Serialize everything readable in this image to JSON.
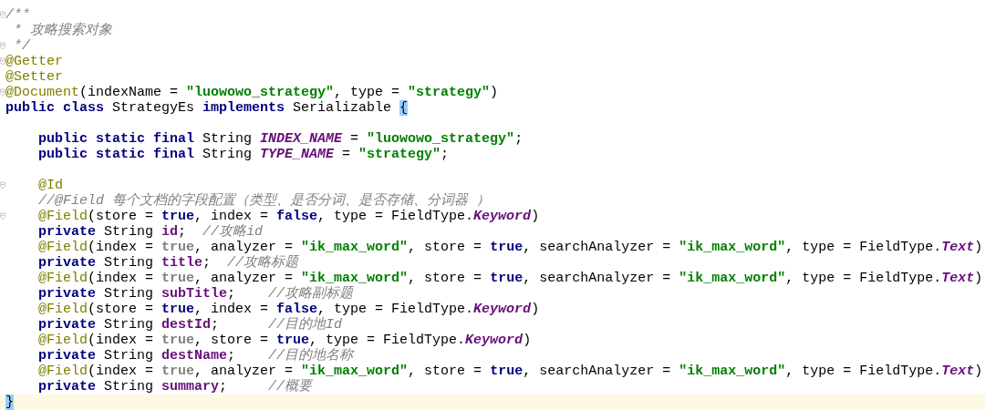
{
  "editor": {
    "lines": [
      {
        "fold": true,
        "current": false,
        "tokens": [
          {
            "kind": "comment",
            "text": "/**"
          }
        ]
      },
      {
        "fold": false,
        "current": false,
        "tokens": [
          {
            "kind": "comment",
            "text": " * 攻略搜索对象"
          }
        ]
      },
      {
        "fold": true,
        "current": false,
        "tokens": [
          {
            "kind": "comment",
            "text": " */"
          }
        ]
      },
      {
        "fold": true,
        "current": false,
        "tokens": [
          {
            "kind": "annotation",
            "text": "@Getter"
          }
        ]
      },
      {
        "fold": false,
        "current": false,
        "tokens": [
          {
            "kind": "annotation",
            "text": "@Setter"
          }
        ]
      },
      {
        "fold": true,
        "current": false,
        "tokens": [
          {
            "kind": "annotation",
            "text": "@Document"
          },
          {
            "kind": "plain",
            "text": "(indexName = "
          },
          {
            "kind": "string",
            "text": "\"luowowo_strategy\""
          },
          {
            "kind": "plain",
            "text": ", type = "
          },
          {
            "kind": "string",
            "text": "\"strategy\""
          },
          {
            "kind": "plain",
            "text": ")"
          }
        ]
      },
      {
        "fold": false,
        "current": false,
        "tokens": [
          {
            "kind": "keyword",
            "text": "public class"
          },
          {
            "kind": "plain",
            "text": " StrategyEs "
          },
          {
            "kind": "keyword",
            "text": "implements"
          },
          {
            "kind": "plain",
            "text": " Serializable "
          },
          {
            "kind": "match",
            "text": "{"
          }
        ]
      },
      {
        "fold": false,
        "current": false
      },
      {
        "fold": false,
        "current": false,
        "tokens": [
          {
            "kind": "keyword",
            "text": "    public static final"
          },
          {
            "kind": "plain",
            "text": " String "
          },
          {
            "kind": "constant",
            "text": "INDEX_NAME"
          },
          {
            "kind": "plain",
            "text": " = "
          },
          {
            "kind": "string",
            "text": "\"luowowo_strategy\""
          },
          {
            "kind": "plain",
            "text": ";"
          }
        ]
      },
      {
        "fold": false,
        "current": false,
        "tokens": [
          {
            "kind": "keyword",
            "text": "    public static final"
          },
          {
            "kind": "plain",
            "text": " String "
          },
          {
            "kind": "constant",
            "text": "TYPE_NAME"
          },
          {
            "kind": "plain",
            "text": " = "
          },
          {
            "kind": "string",
            "text": "\"strategy\""
          },
          {
            "kind": "plain",
            "text": ";"
          }
        ]
      },
      {
        "fold": false,
        "current": false
      },
      {
        "fold": true,
        "current": false,
        "tokens": [
          {
            "kind": "annotation",
            "text": "    @Id"
          }
        ]
      },
      {
        "fold": false,
        "current": false,
        "tokens": [
          {
            "kind": "comment",
            "text": "    //@Field 每个文档的字段配置（类型、是否分词、是否存储、分词器 ）"
          }
        ]
      },
      {
        "fold": true,
        "current": false,
        "tokens": [
          {
            "kind": "annotation",
            "text": "    @Field"
          },
          {
            "kind": "plain",
            "text": "(store = "
          },
          {
            "kind": "keyword",
            "text": "true"
          },
          {
            "kind": "plain",
            "text": ", index = "
          },
          {
            "kind": "keyword",
            "text": "false"
          },
          {
            "kind": "plain",
            "text": ", type = FieldType."
          },
          {
            "kind": "constant",
            "text": "Keyword"
          },
          {
            "kind": "plain",
            "text": ")"
          }
        ]
      },
      {
        "fold": false,
        "current": false,
        "tokens": [
          {
            "kind": "keyword",
            "text": "    private"
          },
          {
            "kind": "plain",
            "text": " String "
          },
          {
            "kind": "field",
            "text": "id"
          },
          {
            "kind": "plain",
            "text": ";  "
          },
          {
            "kind": "comment",
            "text": "//攻略id"
          }
        ]
      },
      {
        "fold": false,
        "current": false,
        "tokens": [
          {
            "kind": "annotation",
            "text": "    @Field"
          },
          {
            "kind": "plain",
            "text": "(index = "
          },
          {
            "kind": "dim",
            "text": "true"
          },
          {
            "kind": "plain",
            "text": ", analyzer = "
          },
          {
            "kind": "string",
            "text": "\"ik_max_word\""
          },
          {
            "kind": "plain",
            "text": ", store = "
          },
          {
            "kind": "keyword",
            "text": "true"
          },
          {
            "kind": "plain",
            "text": ", searchAnalyzer = "
          },
          {
            "kind": "string",
            "text": "\"ik_max_word\""
          },
          {
            "kind": "plain",
            "text": ", type = FieldType."
          },
          {
            "kind": "constant",
            "text": "Text"
          },
          {
            "kind": "plain",
            "text": ")"
          }
        ]
      },
      {
        "fold": false,
        "current": false,
        "tokens": [
          {
            "kind": "keyword",
            "text": "    private"
          },
          {
            "kind": "plain",
            "text": " String "
          },
          {
            "kind": "field",
            "text": "title"
          },
          {
            "kind": "plain",
            "text": ";  "
          },
          {
            "kind": "comment",
            "text": "//攻略标题"
          }
        ]
      },
      {
        "fold": false,
        "current": false,
        "tokens": [
          {
            "kind": "annotation",
            "text": "    @Field"
          },
          {
            "kind": "plain",
            "text": "(index = "
          },
          {
            "kind": "dim",
            "text": "true"
          },
          {
            "kind": "plain",
            "text": ", analyzer = "
          },
          {
            "kind": "string",
            "text": "\"ik_max_word\""
          },
          {
            "kind": "plain",
            "text": ", store = "
          },
          {
            "kind": "keyword",
            "text": "true"
          },
          {
            "kind": "plain",
            "text": ", searchAnalyzer = "
          },
          {
            "kind": "string",
            "text": "\"ik_max_word\""
          },
          {
            "kind": "plain",
            "text": ", type = FieldType."
          },
          {
            "kind": "constant",
            "text": "Text"
          },
          {
            "kind": "plain",
            "text": ")"
          }
        ]
      },
      {
        "fold": false,
        "current": false,
        "tokens": [
          {
            "kind": "keyword",
            "text": "    private"
          },
          {
            "kind": "plain",
            "text": " String "
          },
          {
            "kind": "field",
            "text": "subTitle"
          },
          {
            "kind": "plain",
            "text": ";    "
          },
          {
            "kind": "comment",
            "text": "//攻略副标题"
          }
        ]
      },
      {
        "fold": false,
        "current": false,
        "tokens": [
          {
            "kind": "annotation",
            "text": "    @Field"
          },
          {
            "kind": "plain",
            "text": "(store = "
          },
          {
            "kind": "keyword",
            "text": "true"
          },
          {
            "kind": "plain",
            "text": ", index = "
          },
          {
            "kind": "keyword",
            "text": "false"
          },
          {
            "kind": "plain",
            "text": ", type = FieldType."
          },
          {
            "kind": "constant",
            "text": "Keyword"
          },
          {
            "kind": "plain",
            "text": ")"
          }
        ]
      },
      {
        "fold": false,
        "current": false,
        "tokens": [
          {
            "kind": "keyword",
            "text": "    private"
          },
          {
            "kind": "plain",
            "text": " String "
          },
          {
            "kind": "field",
            "text": "destId"
          },
          {
            "kind": "plain",
            "text": ";      "
          },
          {
            "kind": "comment",
            "text": "//目的地Id"
          }
        ]
      },
      {
        "fold": false,
        "current": false,
        "tokens": [
          {
            "kind": "annotation",
            "text": "    @Field"
          },
          {
            "kind": "plain",
            "text": "(index = "
          },
          {
            "kind": "dim",
            "text": "true"
          },
          {
            "kind": "plain",
            "text": ", store = "
          },
          {
            "kind": "keyword",
            "text": "true"
          },
          {
            "kind": "plain",
            "text": ", type = FieldType."
          },
          {
            "kind": "constant",
            "text": "Keyword"
          },
          {
            "kind": "plain",
            "text": ")"
          }
        ]
      },
      {
        "fold": false,
        "current": false,
        "tokens": [
          {
            "kind": "keyword",
            "text": "    private"
          },
          {
            "kind": "plain",
            "text": " String "
          },
          {
            "kind": "field",
            "text": "destName"
          },
          {
            "kind": "plain",
            "text": ";    "
          },
          {
            "kind": "comment",
            "text": "//目的地名称"
          }
        ]
      },
      {
        "fold": false,
        "current": false,
        "tokens": [
          {
            "kind": "annotation",
            "text": "    @Field"
          },
          {
            "kind": "plain",
            "text": "(index = "
          },
          {
            "kind": "dim",
            "text": "true"
          },
          {
            "kind": "plain",
            "text": ", analyzer = "
          },
          {
            "kind": "string",
            "text": "\"ik_max_word\""
          },
          {
            "kind": "plain",
            "text": ", store = "
          },
          {
            "kind": "keyword",
            "text": "true"
          },
          {
            "kind": "plain",
            "text": ", searchAnalyzer = "
          },
          {
            "kind": "string",
            "text": "\"ik_max_word\""
          },
          {
            "kind": "plain",
            "text": ", type = FieldType."
          },
          {
            "kind": "constant",
            "text": "Text"
          },
          {
            "kind": "plain",
            "text": ")"
          }
        ]
      },
      {
        "fold": false,
        "current": false,
        "tokens": [
          {
            "kind": "keyword",
            "text": "    private"
          },
          {
            "kind": "plain",
            "text": " String "
          },
          {
            "kind": "field",
            "text": "summary"
          },
          {
            "kind": "plain",
            "text": ";     "
          },
          {
            "kind": "comment",
            "text": "//概要"
          }
        ]
      },
      {
        "fold": false,
        "current": true,
        "tokens": [
          {
            "kind": "match",
            "text": "}"
          }
        ]
      }
    ]
  }
}
